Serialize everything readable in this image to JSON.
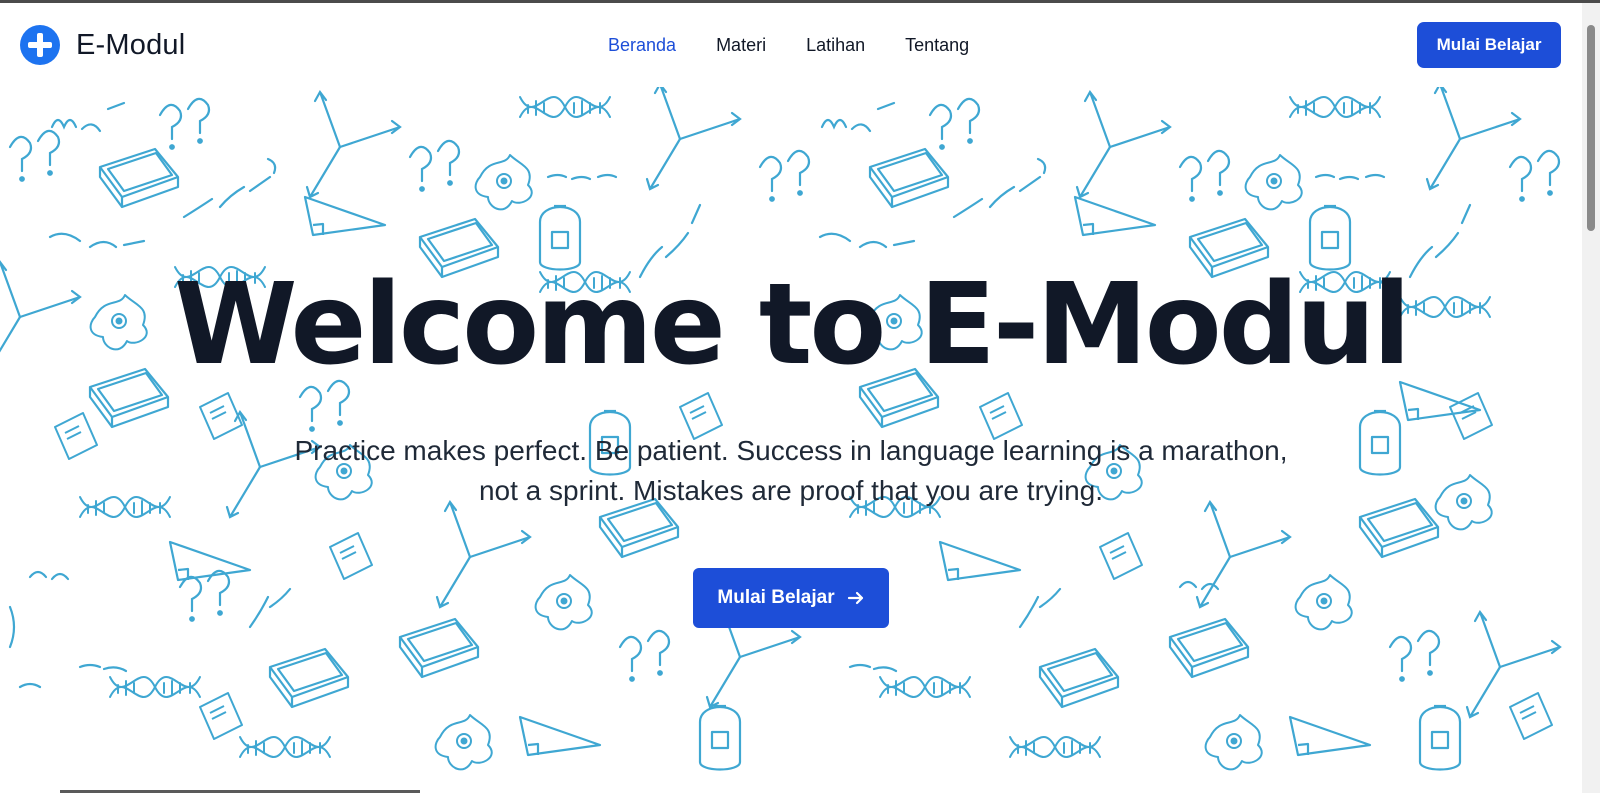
{
  "brand": {
    "name": "E-Modul",
    "logo_icon": "plus-circle-icon",
    "logo_color": "#1d73f0"
  },
  "nav": {
    "links": [
      {
        "label": "Beranda",
        "active": true
      },
      {
        "label": "Materi",
        "active": false
      },
      {
        "label": "Latihan",
        "active": false
      },
      {
        "label": "Tentang",
        "active": false
      }
    ],
    "cta_label": "Mulai Belajar"
  },
  "hero": {
    "title": "Welcome to E-Modul",
    "subtitle_line1": "Practice makes perfect. Be patient. Success in language learning is a marathon,",
    "subtitle_line2": "not a sprint. Mistakes are proof that you are trying.",
    "cta_label": "Mulai Belajar",
    "cta_icon": "arrow-right-icon",
    "background_pattern": "doodle-pattern-math-science",
    "pattern_color": "#35a3d0"
  },
  "colors": {
    "accent": "#1d4ed8",
    "text": "#111827"
  }
}
